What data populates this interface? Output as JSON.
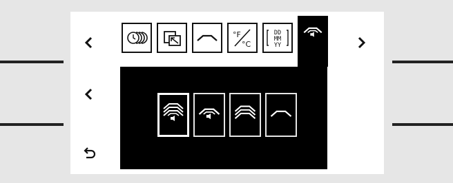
{
  "screen": {
    "tabs": [
      {
        "name": "timer-tab",
        "icon": "timer-icon",
        "active": false
      },
      {
        "name": "cycle-tab",
        "icon": "cycle-arrows-icon",
        "active": false
      },
      {
        "name": "hood-tab",
        "icon": "hood-icon",
        "active": false
      },
      {
        "name": "temperature-unit-tab",
        "icon": "fahrenheit-celsius-icon",
        "label": "°F/°C",
        "active": false
      },
      {
        "name": "date-format-tab",
        "icon": "date-format-icon",
        "label_lines": [
          "DD",
          "MM",
          "YY"
        ],
        "active": false
      },
      {
        "name": "hood-sound-tab",
        "icon": "hood-sound-icon",
        "active": true
      }
    ],
    "options": [
      {
        "name": "hood-sound-high-option",
        "icon": "hood-sound-high-icon",
        "selected": true
      },
      {
        "name": "hood-sound-option",
        "icon": "hood-sound-icon",
        "selected": false
      },
      {
        "name": "hood-high-option",
        "icon": "hood-high-icon",
        "selected": false
      },
      {
        "name": "hood-option",
        "icon": "hood-icon",
        "selected": false
      }
    ],
    "nav": {
      "prev_tab_icon": "chevron-left-icon",
      "next_tab_icon": "chevron-right-icon",
      "prev_option_icon": "chevron-left-icon",
      "back_icon": "back-arrow-icon"
    }
  }
}
